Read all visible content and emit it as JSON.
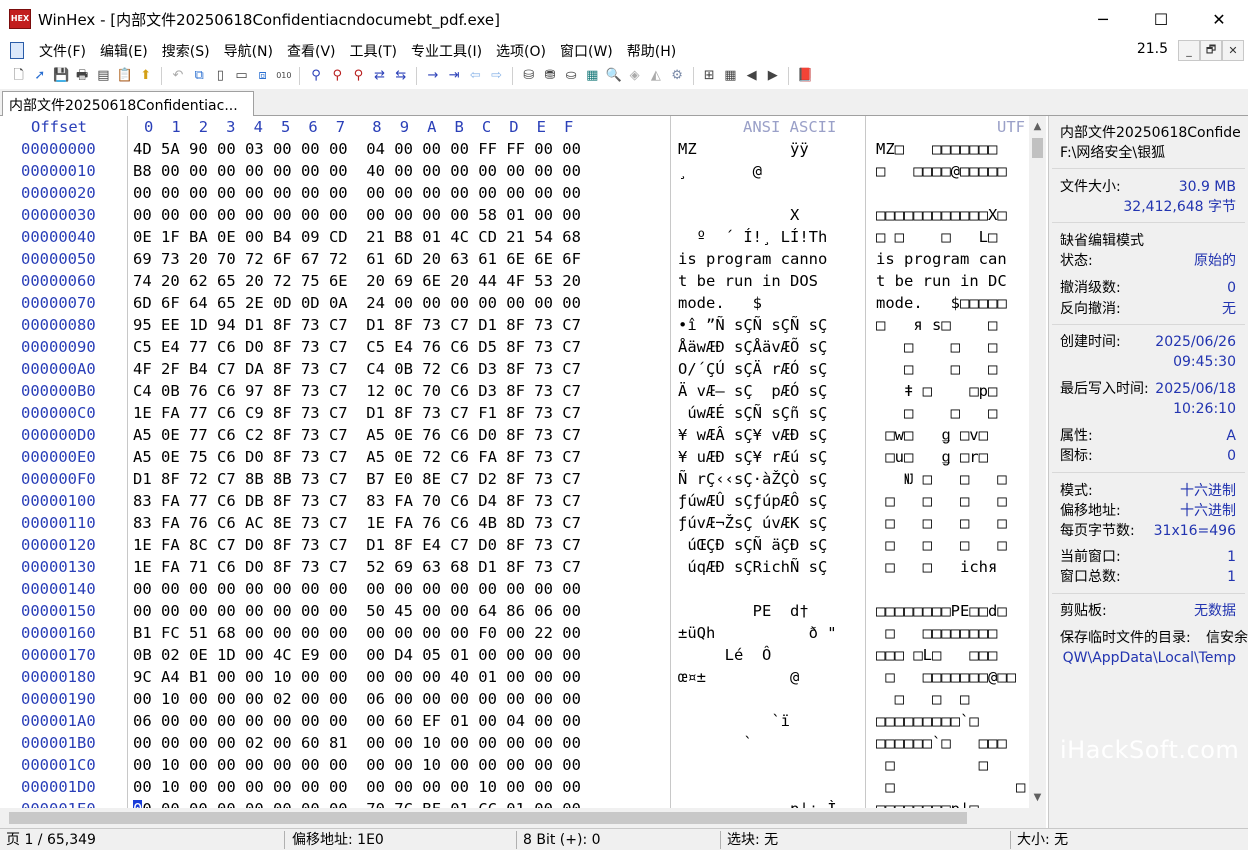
{
  "window": {
    "app_icon_text": "HEX",
    "title": "WinHex - [内部文件20250618Confidentiacndocumebt_pdf.exe]",
    "minimize": "─",
    "maximize": "☐",
    "close": "✕"
  },
  "menu": {
    "items": [
      "文件(F)",
      "编辑(E)",
      "搜索(S)",
      "导航(N)",
      "查看(V)",
      "工具(T)",
      "专业工具(I)",
      "选项(O)",
      "窗口(W)",
      "帮助(H)"
    ],
    "zoom": "21.5",
    "mdi_min": "_",
    "mdi_restore": "🗗",
    "mdi_close": "✕"
  },
  "tab": {
    "label": "内部文件20250618Confidentiac..."
  },
  "header": {
    "offset": "Offset",
    "hex_cols": "0  1  2  3  4  5  6  7   8  9  A  B  C  D  E  F",
    "ansi": "ANSI ASCII",
    "utf": "UTF"
  },
  "offsets": [
    "00000000",
    "00000010",
    "00000020",
    "00000030",
    "00000040",
    "00000050",
    "00000060",
    "00000070",
    "00000080",
    "00000090",
    "000000A0",
    "000000B0",
    "000000C0",
    "000000D0",
    "000000E0",
    "000000F0",
    "00000100",
    "00000110",
    "00000120",
    "00000130",
    "00000140",
    "00000150",
    "00000160",
    "00000170",
    "00000180",
    "00000190",
    "000001A0",
    "000001B0",
    "000001C0",
    "000001D0",
    "000001E0"
  ],
  "hex_rows": [
    "4D 5A 90 00 03 00 00 00  04 00 00 00 FF FF 00 00",
    "B8 00 00 00 00 00 00 00  40 00 00 00 00 00 00 00",
    "00 00 00 00 00 00 00 00  00 00 00 00 00 00 00 00",
    "00 00 00 00 00 00 00 00  00 00 00 00 58 01 00 00",
    "0E 1F BA 0E 00 B4 09 CD  21 B8 01 4C CD 21 54 68",
    "69 73 20 70 72 6F 67 72  61 6D 20 63 61 6E 6E 6F",
    "74 20 62 65 20 72 75 6E  20 69 6E 20 44 4F 53 20",
    "6D 6F 64 65 2E 0D 0D 0A  24 00 00 00 00 00 00 00",
    "95 EE 1D 94 D1 8F 73 C7  D1 8F 73 C7 D1 8F 73 C7",
    "C5 E4 77 C6 D0 8F 73 C7  C5 E4 76 C6 D5 8F 73 C7",
    "4F 2F B4 C7 DA 8F 73 C7  C4 0B 72 C6 D3 8F 73 C7",
    "C4 0B 76 C6 97 8F 73 C7  12 0C 70 C6 D3 8F 73 C7",
    "1E FA 77 C6 C9 8F 73 C7  D1 8F 73 C7 F1 8F 73 C7",
    "A5 0E 77 C6 C2 8F 73 C7  A5 0E 76 C6 D0 8F 73 C7",
    "A5 0E 75 C6 D0 8F 73 C7  A5 0E 72 C6 FA 8F 73 C7",
    "D1 8F 72 C7 8B 8B 73 C7  B7 E0 8E C7 D2 8F 73 C7",
    "83 FA 77 C6 DB 8F 73 C7  83 FA 70 C6 D4 8F 73 C7",
    "83 FA 76 C6 AC 8E 73 C7  1E FA 76 C6 4B 8D 73 C7",
    "1E FA 8C C7 D0 8F 73 C7  D1 8F E4 C7 D0 8F 73 C7",
    "1E FA 71 C6 D0 8F 73 C7  52 69 63 68 D1 8F 73 C7",
    "00 00 00 00 00 00 00 00  00 00 00 00 00 00 00 00",
    "00 00 00 00 00 00 00 00  50 45 00 00 64 86 06 00",
    "B1 FC 51 68 00 00 00 00  00 00 00 00 F0 00 22 00",
    "0B 02 0E 1D 00 4C E9 00  00 D4 05 01 00 00 00 00",
    "9C A4 B1 00 00 10 00 00  00 00 00 40 01 00 00 00",
    "00 10 00 00 00 02 00 00  06 00 00 00 00 00 00 00",
    "06 00 00 00 00 00 00 00  00 60 EF 01 00 04 00 00",
    "00 00 00 00 02 00 60 81  00 00 10 00 00 00 00 00",
    "00 10 00 00 00 00 00 00  00 00 10 00 00 00 00 00",
    "00 10 00 00 00 00 00 00  00 00 00 00 10 00 00 00"
  ],
  "last_row": {
    "cursor": "0",
    "rest": "0 00 00 00 00 00 00 00  70 7C BF 01 CC 01 00 00"
  },
  "ansi_rows": [
    "MZ          ÿÿ",
    "¸       @",
    "",
    "            X",
    "  º  ´ Í!¸ LÍ!Th",
    "is program canno",
    "t be run in DOS",
    "mode.   $",
    "•î ”Ñ sÇÑ sÇÑ sÇ",
    "ÅäwÆÐ sÇÅävÆÕ sÇ",
    "O/´ÇÚ sÇÄ rÆÓ sÇ",
    "Ä vÆ— sÇ  pÆÓ sÇ",
    " úwÆÉ sÇÑ sÇñ sÇ",
    "¥ wÆÂ sÇ¥ vÆÐ sÇ",
    "¥ uÆÐ sÇ¥ rÆú sÇ",
    "Ñ rÇ‹‹sÇ·àŽÇÒ sÇ",
    "ƒúwÆÛ sÇƒúpÆÔ sÇ",
    "ƒúvÆ¬ŽsÇ úvÆK sÇ",
    " úŒÇÐ sÇÑ äÇÐ sÇ",
    " úqÆÐ sÇRichÑ sÇ",
    "",
    "        PE  d†",
    "±üQh          ð \"",
    "     Lé  Ô",
    "œ¤±         @",
    "",
    "          `ï",
    "       `",
    "",
    "",
    "            p|¿ Ì"
  ],
  "utf_rows": [
    "MZ□   □□□□□□□",
    "□   □□□□@□□□□□",
    "",
    "□□□□□□□□□□□□X□",
    "□ □    □   L□",
    "is program can",
    "t be run in DC",
    "mode.   $□□□□□",
    "□   я s□    □",
    "   □    □   □",
    "   □    □   □",
    "   ǂ □    □p□",
    "   □    □   □",
    " □w□   ǥ □v□",
    " □u□   ǥ □r□",
    "   Ǌ □   □   □",
    " □   □   □   □",
    " □   □   □   □",
    " □   □   □   □",
    " □   □   ichя",
    "",
    "□□□□□□□□PE□□d□",
    " □   □□□□□□□□",
    "□□□ □L□   □□□",
    " □   □□□□□□□@□□",
    "  □   □  □",
    "□□□□□□□□□`□",
    "□□□□□□`□   □□□",
    " □         □",
    " □             □",
    "□□□□□□□□p|□"
  ],
  "info": {
    "file_name": "内部文件20250618Confide",
    "path": "F:\\网络安全\\银狐",
    "size_label": "文件大小:",
    "size_mb": "30.9 MB",
    "size_bytes": "32,412,648 字节",
    "edit_mode": "缺省编辑模式",
    "state_label": "状态:",
    "state_value": "原始的",
    "undo_level_label": "撤消级数:",
    "undo_level_value": "0",
    "reverse_undo_label": "反向撤消:",
    "reverse_undo_value": "无",
    "created_label": "创建时间:",
    "created_date": "2025/06/26",
    "created_time": "09:45:30",
    "written_label": "最后写入时间:",
    "written_date": "2025/06/18",
    "written_time": "10:26:10",
    "attr_label": "属性:",
    "attr_value": "A",
    "icon_label": "图标:",
    "icon_value": "0",
    "mode_label": "模式:",
    "mode_value": "十六进制",
    "offset_addr_label": "偏移地址:",
    "offset_addr_value": "十六进制",
    "bytes_per_page_label": "每页字节数:",
    "bytes_per_page_value": "31x16=496",
    "current_window_label": "当前窗口:",
    "current_window_value": "1",
    "window_total_label": "窗口总数:",
    "window_total_value": "1",
    "clipboard_label": "剪贴板:",
    "clipboard_value": "无数据",
    "temp_label": "保存临时文件的目录:",
    "temp_overlap": "信安余",
    "temp_path": "QW\\AppData\\Local\\Temp"
  },
  "watermark": "iHackSoft.com",
  "status": {
    "page": "页 1 / 65,349",
    "offset": "偏移地址: 1E0",
    "bits": "8 Bit (+): 0",
    "selection": "选块: 无",
    "size": "大小: 无"
  }
}
